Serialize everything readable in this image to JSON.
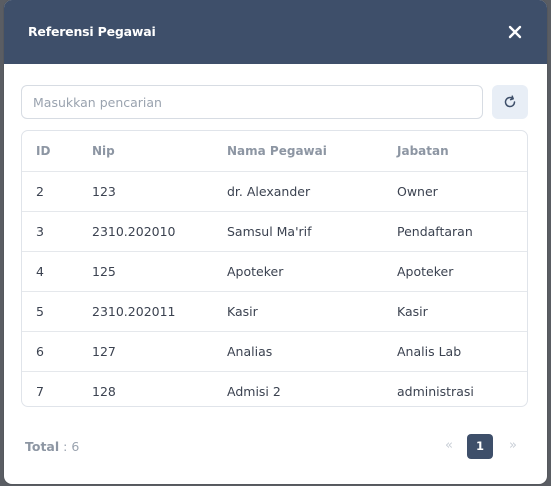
{
  "modal": {
    "title": "Referensi Pegawai",
    "close_icon": "close-icon"
  },
  "search": {
    "placeholder": "Masukkan pencarian",
    "value": "",
    "refresh_icon": "refresh-icon"
  },
  "table": {
    "headers": [
      "ID",
      "Nip",
      "Nama Pegawai",
      "Jabatan"
    ],
    "rows": [
      [
        "2",
        "123",
        "dr. Alexander",
        "Owner"
      ],
      [
        "3",
        "2310.202010",
        "Samsul Ma'rif",
        "Pendaftaran"
      ],
      [
        "4",
        "125",
        "Apoteker",
        "Apoteker"
      ],
      [
        "5",
        "2310.202011",
        "Kasir",
        "Kasir"
      ],
      [
        "6",
        "127",
        "Analias",
        "Analis Lab"
      ],
      [
        "7",
        "128",
        "Admisi 2",
        "administrasi"
      ]
    ]
  },
  "footer": {
    "total_label": "Total",
    "total_separator": " : ",
    "total_value": "6"
  },
  "pagination": {
    "prev": "«",
    "current": "1",
    "next": "»"
  },
  "colors": {
    "header_bg": "#3e4f6a",
    "accent": "#3e4f6a"
  }
}
